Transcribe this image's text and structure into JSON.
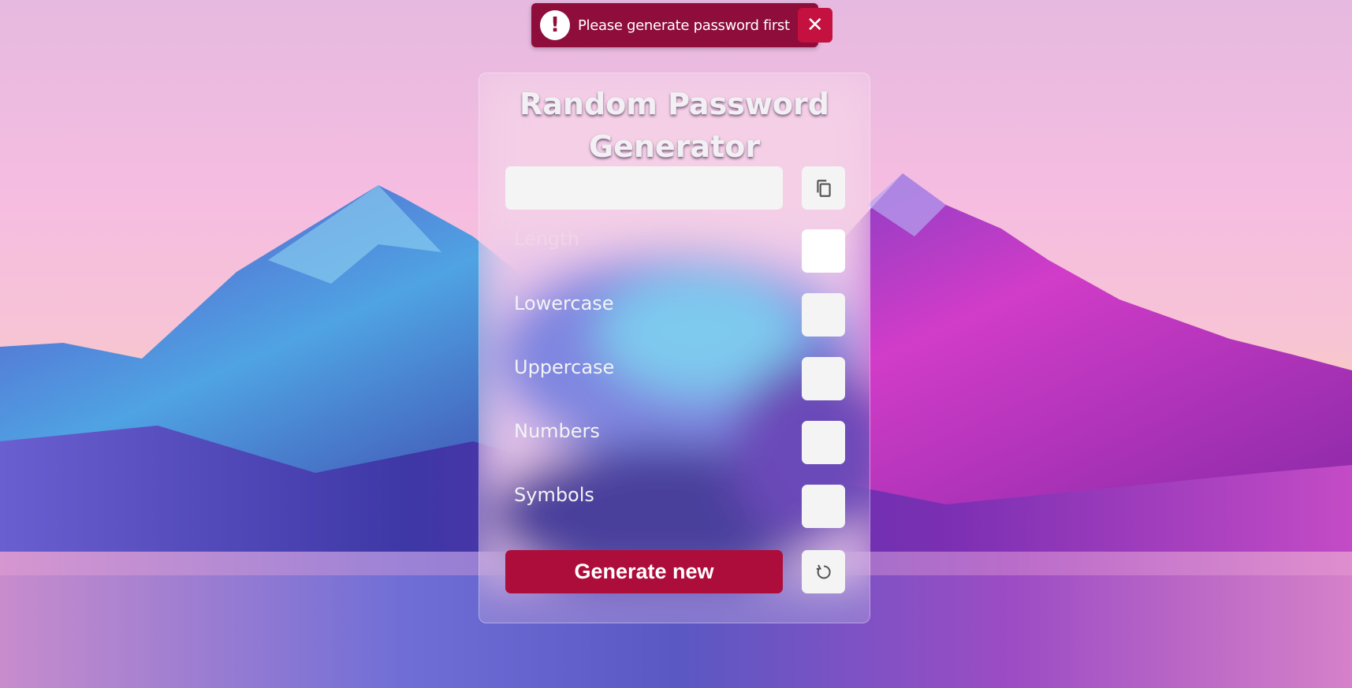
{
  "toast": {
    "icon": "exclamation-icon",
    "icon_glyph": "!",
    "message": "Please generate password first",
    "close_glyph": "✕"
  },
  "panel": {
    "title_line1": "Random Password",
    "title_line2": "Generator",
    "password_value": "",
    "copy_icon": "copy-icon",
    "options": [
      {
        "label": "Length",
        "value": ""
      },
      {
        "label": "Lowercase",
        "checked": false
      },
      {
        "label": "Uppercase",
        "checked": false
      },
      {
        "label": "Numbers",
        "checked": false
      },
      {
        "label": "Symbols",
        "checked": false
      }
    ],
    "generate_label": "Generate new",
    "reset_icon": "refresh-icon"
  },
  "colors": {
    "accent": "#ad0d3a",
    "toast_bg": "#8e0d3a",
    "toast_close_bg": "#c4113f",
    "input_bg": "#f4f4f4"
  }
}
